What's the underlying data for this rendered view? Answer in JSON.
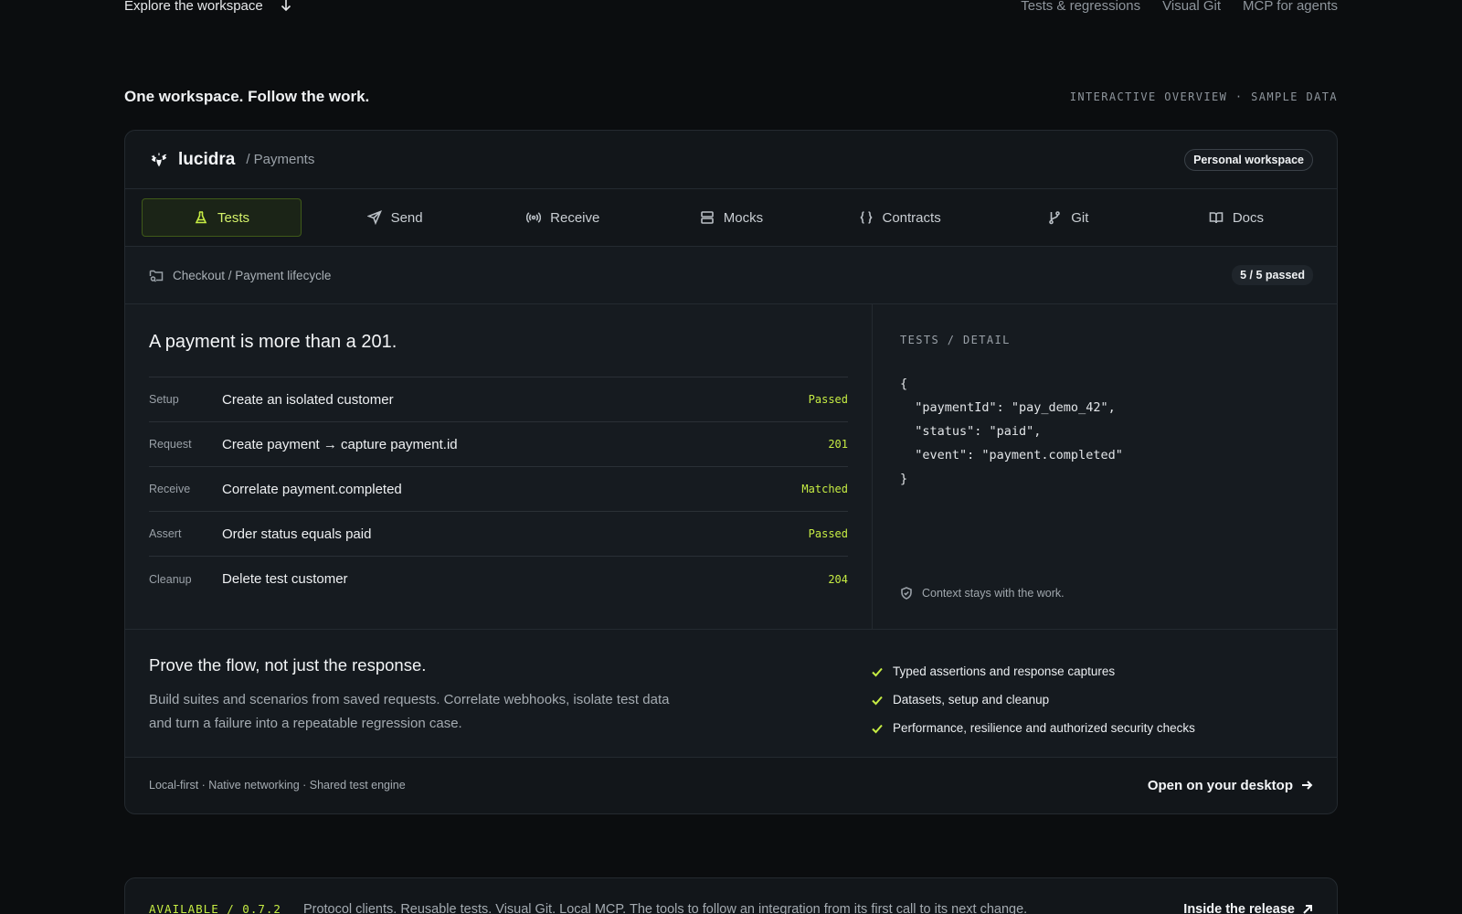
{
  "nav": {
    "explore_label": "Explore the workspace",
    "links": [
      "Tests & regressions",
      "Visual Git",
      "MCP for agents"
    ]
  },
  "section": {
    "title": "One workspace. Follow the work.",
    "tag": "INTERACTIVE OVERVIEW · SAMPLE DATA"
  },
  "app": {
    "brand": "lucidra",
    "crumb": "/ Payments",
    "workspace_badge": "Personal workspace",
    "tabs": [
      {
        "label": "Tests",
        "icon": "flask-icon",
        "active": true
      },
      {
        "label": "Send",
        "icon": "send-icon"
      },
      {
        "label": "Receive",
        "icon": "broadcast-icon"
      },
      {
        "label": "Mocks",
        "icon": "server-icon"
      },
      {
        "label": "Contracts",
        "icon": "braces-icon"
      },
      {
        "label": "Git",
        "icon": "git-branch-icon"
      },
      {
        "label": "Docs",
        "icon": "book-icon"
      }
    ],
    "path": "Checkout / Payment lifecycle",
    "passed_count": "5 / 5 passed"
  },
  "flow": {
    "title": "A payment is more than a 201.",
    "steps": [
      {
        "kind": "Setup",
        "text": "Create an isolated customer",
        "status": "Passed"
      },
      {
        "kind": "Request",
        "text": "Create payment → capture payment.id",
        "status": "201"
      },
      {
        "kind": "Receive",
        "text": "Correlate payment.completed",
        "status": "Matched"
      },
      {
        "kind": "Assert",
        "text": "Order status equals paid",
        "status": "Passed"
      },
      {
        "kind": "Cleanup",
        "text": "Delete test customer",
        "status": "204"
      }
    ]
  },
  "detail": {
    "label": "TESTS / DETAIL",
    "json": "{\n  \"paymentId\": \"pay_demo_42\",\n  \"status\": \"paid\",\n  \"event\": \"payment.completed\"\n}",
    "context_note": "Context stays with the work."
  },
  "prove": {
    "title": "Prove the flow, not just the response.",
    "description": "Build suites and scenarios from saved requests. Correlate webhooks, isolate test data and turn a failure into a repeatable regression case.",
    "features": [
      "Typed assertions and response captures",
      "Datasets, setup and cleanup",
      "Performance, resilience and authorized security checks"
    ]
  },
  "footer": {
    "meta": "Local-first · Native networking · Shared test engine",
    "cta": "Open on your desktop"
  },
  "release": {
    "version": "AVAILABLE / 0.7.2",
    "description": "Protocol clients. Reusable tests. Visual Git. Local MCP. The tools to follow an integration from its first call to its next change.",
    "link": "Inside the release"
  },
  "colors": {
    "accent": "#c6ec43",
    "background": "#0b0d0f",
    "card": "#12161a"
  }
}
